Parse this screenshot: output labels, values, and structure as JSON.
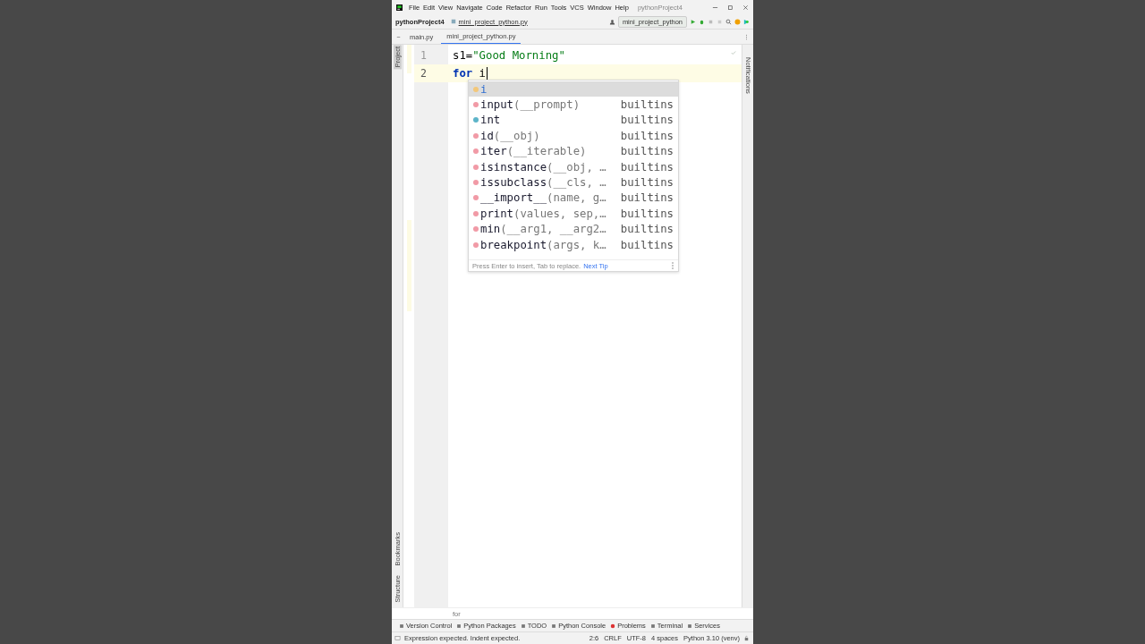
{
  "title_bar": {
    "menu": [
      "File",
      "Edit",
      "View",
      "Navigate",
      "Code",
      "Refactor",
      "Run",
      "Tools",
      "VCS",
      "Window",
      "Help"
    ],
    "title": "pythonProject4"
  },
  "nav_bar": {
    "project": "pythonProject4",
    "file": "mini_project_python.py",
    "run_config": "mini_project_python"
  },
  "tabs": [
    {
      "label": "main.py",
      "selected": false
    },
    {
      "label": "mini_project_python.py",
      "selected": true
    }
  ],
  "left_tools": {
    "top": [
      "Project"
    ],
    "bottom": [
      "Bookmarks",
      "Structure"
    ]
  },
  "right_tools": [
    "Notifications"
  ],
  "editor": {
    "lines": [
      {
        "number": "1",
        "current": false,
        "segments": [
          {
            "kind": "plain",
            "text": "s1="
          },
          {
            "kind": "string",
            "text": "\"Good Morning\""
          }
        ]
      },
      {
        "number": "2",
        "current": true,
        "segments": [
          {
            "kind": "keyword",
            "text": "for"
          },
          {
            "kind": "plain",
            "text": " i "
          }
        ]
      }
    ]
  },
  "completion": {
    "items": [
      {
        "kind": "variable",
        "name": "i",
        "selected": true
      },
      {
        "kind": "function",
        "name": "input",
        "params": "(__prompt)",
        "source": "builtins",
        "selected": false
      },
      {
        "kind": "class",
        "name": "int",
        "source": "builtins",
        "selected": false
      },
      {
        "kind": "function",
        "name": "id",
        "params": "(__obj)",
        "source": "builtins",
        "selected": false
      },
      {
        "kind": "function",
        "name": "iter",
        "params": "(__iterable)",
        "source": "builtins",
        "selected": false
      },
      {
        "kind": "function",
        "name": "isinstance",
        "params": "(__obj, …",
        "source": "builtins",
        "selected": false
      },
      {
        "kind": "function",
        "name": "issubclass",
        "params": "(__cls, …",
        "source": "builtins",
        "selected": false
      },
      {
        "kind": "function",
        "name": "__import__",
        "params": "(name, g…",
        "source": "builtins",
        "selected": false
      },
      {
        "kind": "function",
        "name": "print",
        "params": "(values, sep,…",
        "source": "builtins",
        "selected": false
      },
      {
        "kind": "function",
        "name": "min",
        "params": "(__arg1, __arg2…",
        "source": "builtins",
        "selected": false
      },
      {
        "kind": "function",
        "name": "breakpoint",
        "params": "(args, k…",
        "source": "builtins",
        "selected": false
      }
    ],
    "footer": "Press Enter to insert, Tab to replace.",
    "tip_link": "Next Tip"
  },
  "breadcrumb": "for",
  "tool_windows": [
    "Version Control",
    "Python Packages",
    "TODO",
    "Python Console",
    "Problems",
    "Terminal",
    "Services"
  ],
  "status": {
    "message": "Expression expected. Indent expected.",
    "items": [
      "2:6",
      "CRLF",
      "UTF-8",
      "4 spaces",
      "Python 3.10 (venv)"
    ]
  }
}
